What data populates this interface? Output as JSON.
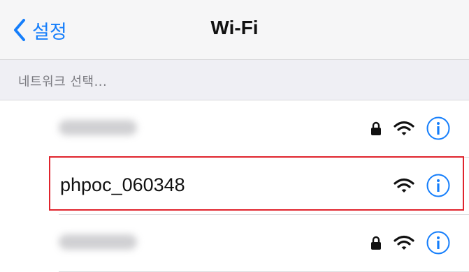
{
  "navbar": {
    "back_label": "설정",
    "title": "Wi-Fi"
  },
  "section_header": "네트워크 선택...",
  "networks": [
    {
      "ssid": "",
      "secured": true,
      "blurred": true
    },
    {
      "ssid": "phpoc_060348",
      "secured": false,
      "blurred": false,
      "highlighted": true
    },
    {
      "ssid": "",
      "secured": true,
      "blurred": true
    }
  ],
  "colors": {
    "accent": "#157efb",
    "highlight": "#e0242d",
    "navbar_bg": "#f6f6f7",
    "section_bg": "#efeff4"
  },
  "icons": {
    "back": "chevron-left-icon",
    "lock": "lock-icon",
    "wifi": "wifi-icon",
    "info": "info-icon"
  }
}
